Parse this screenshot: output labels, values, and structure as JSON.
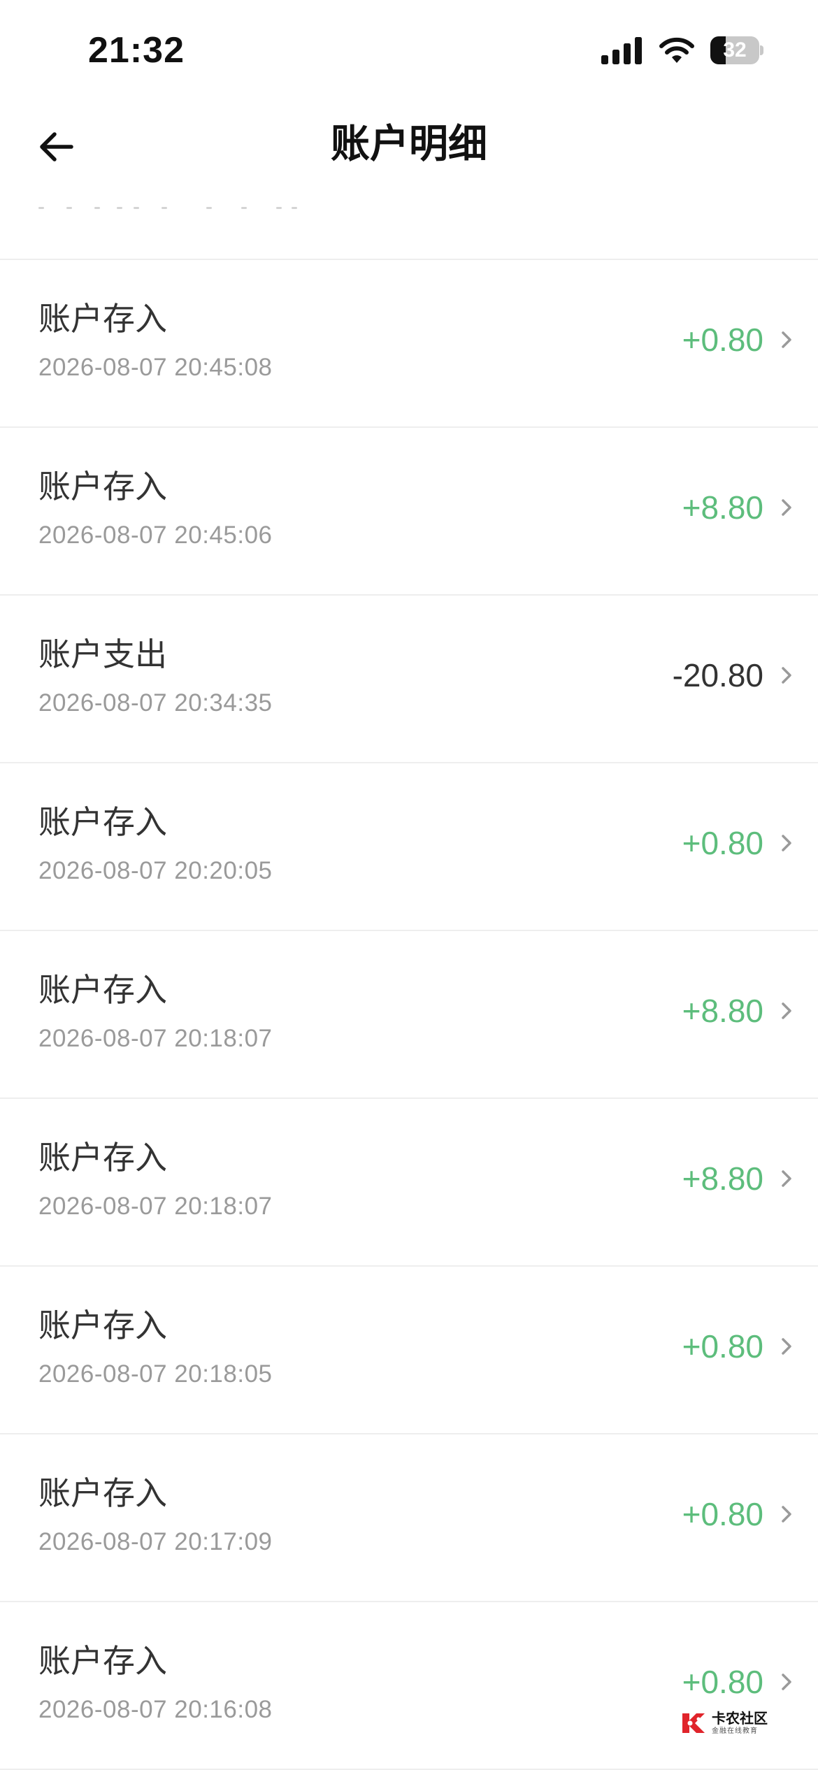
{
  "status_bar": {
    "time": "21:32",
    "battery": "32",
    "battery_level": 0.32
  },
  "header": {
    "title": "账户明细"
  },
  "transactions": [
    {
      "title": "账户存入",
      "time": "2026-08-07 20:45:08",
      "amount": "+0.80",
      "kind": "income"
    },
    {
      "title": "账户存入",
      "time": "2026-08-07 20:45:06",
      "amount": "+8.80",
      "kind": "income"
    },
    {
      "title": "账户支出",
      "time": "2026-08-07 20:34:35",
      "amount": "-20.80",
      "kind": "expense"
    },
    {
      "title": "账户存入",
      "time": "2026-08-07 20:20:05",
      "amount": "+0.80",
      "kind": "income"
    },
    {
      "title": "账户存入",
      "time": "2026-08-07 20:18:07",
      "amount": "+8.80",
      "kind": "income"
    },
    {
      "title": "账户存入",
      "time": "2026-08-07 20:18:07",
      "amount": "+8.80",
      "kind": "income"
    },
    {
      "title": "账户存入",
      "time": "2026-08-07 20:18:05",
      "amount": "+0.80",
      "kind": "income"
    },
    {
      "title": "账户存入",
      "time": "2026-08-07 20:17:09",
      "amount": "+0.80",
      "kind": "income"
    },
    {
      "title": "账户存入",
      "time": "2026-08-07 20:16:08",
      "amount": "+0.80",
      "kind": "income"
    }
  ],
  "colors": {
    "income": "#5dbd7c",
    "expense": "#333333",
    "secondary_text": "#9a9a9a",
    "divider": "#eeeeee"
  },
  "icons": {
    "back": "arrow-left-icon",
    "chevron": "chevron-right-icon",
    "signal": "cellular-signal-icon",
    "wifi": "wifi-icon",
    "battery": "battery-icon"
  },
  "watermark": {
    "name": "卡农社区",
    "sub": "金融在线教育"
  }
}
